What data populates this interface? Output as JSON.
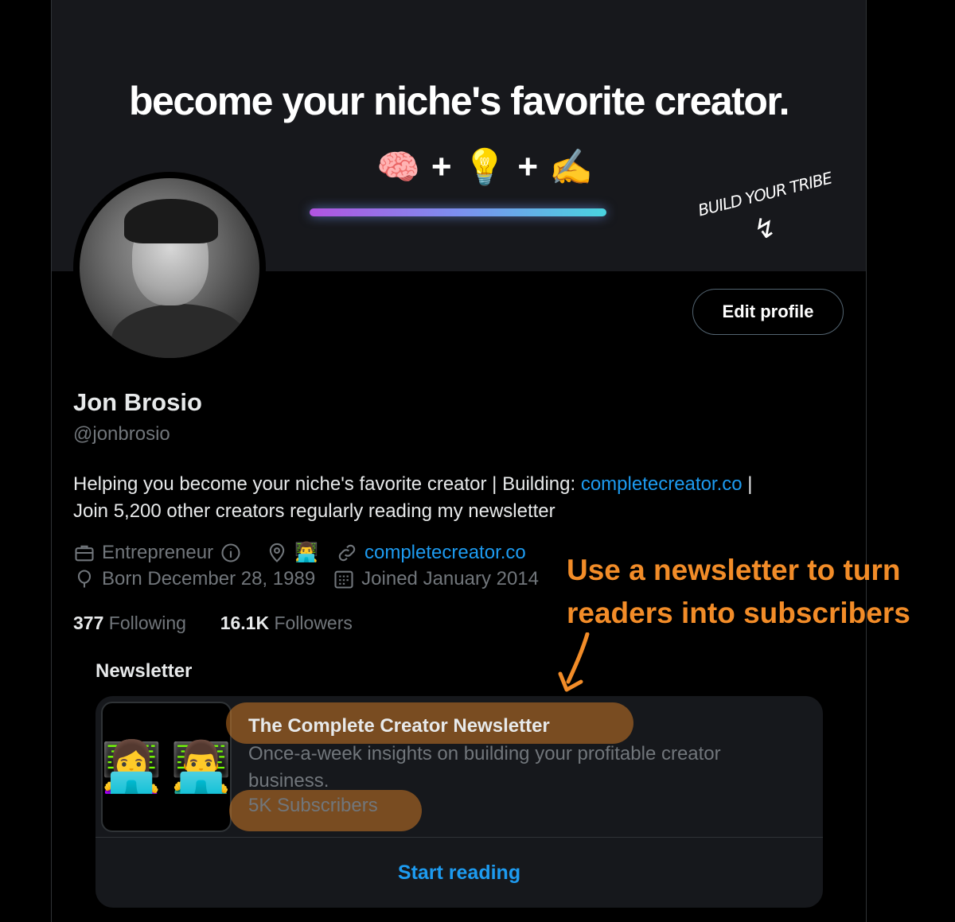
{
  "banner": {
    "headline": "become your niche's favorite creator.",
    "formula": [
      "🧠",
      "+",
      "💡",
      "+",
      "✍️"
    ],
    "sticker_text": "BUILD YOUR TRIBE",
    "sticker_arrow": "↯"
  },
  "profile": {
    "edit_button": "Edit profile",
    "name": "Jon Brosio",
    "handle": "@jonbrosio",
    "bio_line1_prefix": "Helping you become your niche's favorite creator | Building: ",
    "bio_link": "completecreator.co",
    "bio_line1_suffix": " |",
    "bio_line2": "Join 5,200 other creators regularly reading my newsletter",
    "category": "Entrepreneur",
    "location_emoji": "👨‍💻",
    "website": "completecreator.co",
    "birthday": "Born December 28, 1989",
    "joined": "Joined January 2014",
    "following_count": "377",
    "following_label": "Following",
    "followers_count": "16.1K",
    "followers_label": "Followers"
  },
  "annotation": {
    "line1": "Use a newsletter to turn",
    "line2": "readers into subscribers",
    "color": "#f28c28"
  },
  "newsletter": {
    "section_label": "Newsletter",
    "thumb_emojis": [
      "👩‍💻",
      "👨‍💻"
    ],
    "title": "The Complete Creator Newsletter",
    "description": "Once-a-week insights on building your profitable creator business.",
    "subscribers": "5K Subscribers",
    "cta": "Start reading"
  },
  "colors": {
    "accent": "#1d9bf0",
    "muted": "#71767b",
    "background": "#000000"
  }
}
